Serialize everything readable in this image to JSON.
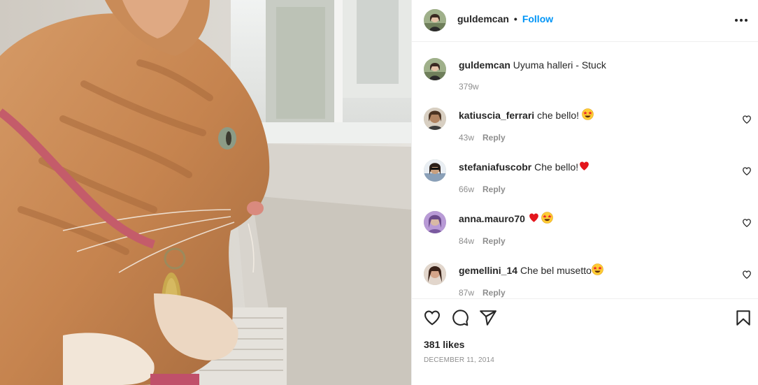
{
  "post": {
    "author": "guldemcan",
    "dot": "•",
    "follow_label": "Follow",
    "caption_user": "guldemcan",
    "caption_text": "Uyuma halleri - Stuck",
    "caption_time": "379w"
  },
  "comments": [
    {
      "user": "katiuscia_ferrari",
      "text": "che bello! ",
      "emoji": "star-struck-emoji",
      "time": "43w",
      "reply_label": "Reply"
    },
    {
      "user": "stefaniafuscobr",
      "text": "Che bello!",
      "emoji": "red-heart-emoji",
      "time": "66w",
      "reply_label": "Reply"
    },
    {
      "user": "anna.mauro70",
      "text": "",
      "emoji": "red-heart-and-star-struck-emoji",
      "time": "84w",
      "reply_label": "Reply"
    },
    {
      "user": "gemellini_14",
      "text": "Che bel musetto",
      "emoji": "star-struck-emoji",
      "time": "87w",
      "reply_label": "Reply"
    }
  ],
  "stats": {
    "likes": "381 likes",
    "date": "DECEMBER 11, 2014"
  },
  "icons": {
    "like": "heart-icon",
    "comment": "comment-icon",
    "share": "share-icon",
    "save": "bookmark-icon",
    "more": "more-options-icon"
  },
  "colors": {
    "accent": "#0095f6",
    "text": "#262626",
    "muted": "#8e8e8e",
    "divider": "#efefef"
  }
}
